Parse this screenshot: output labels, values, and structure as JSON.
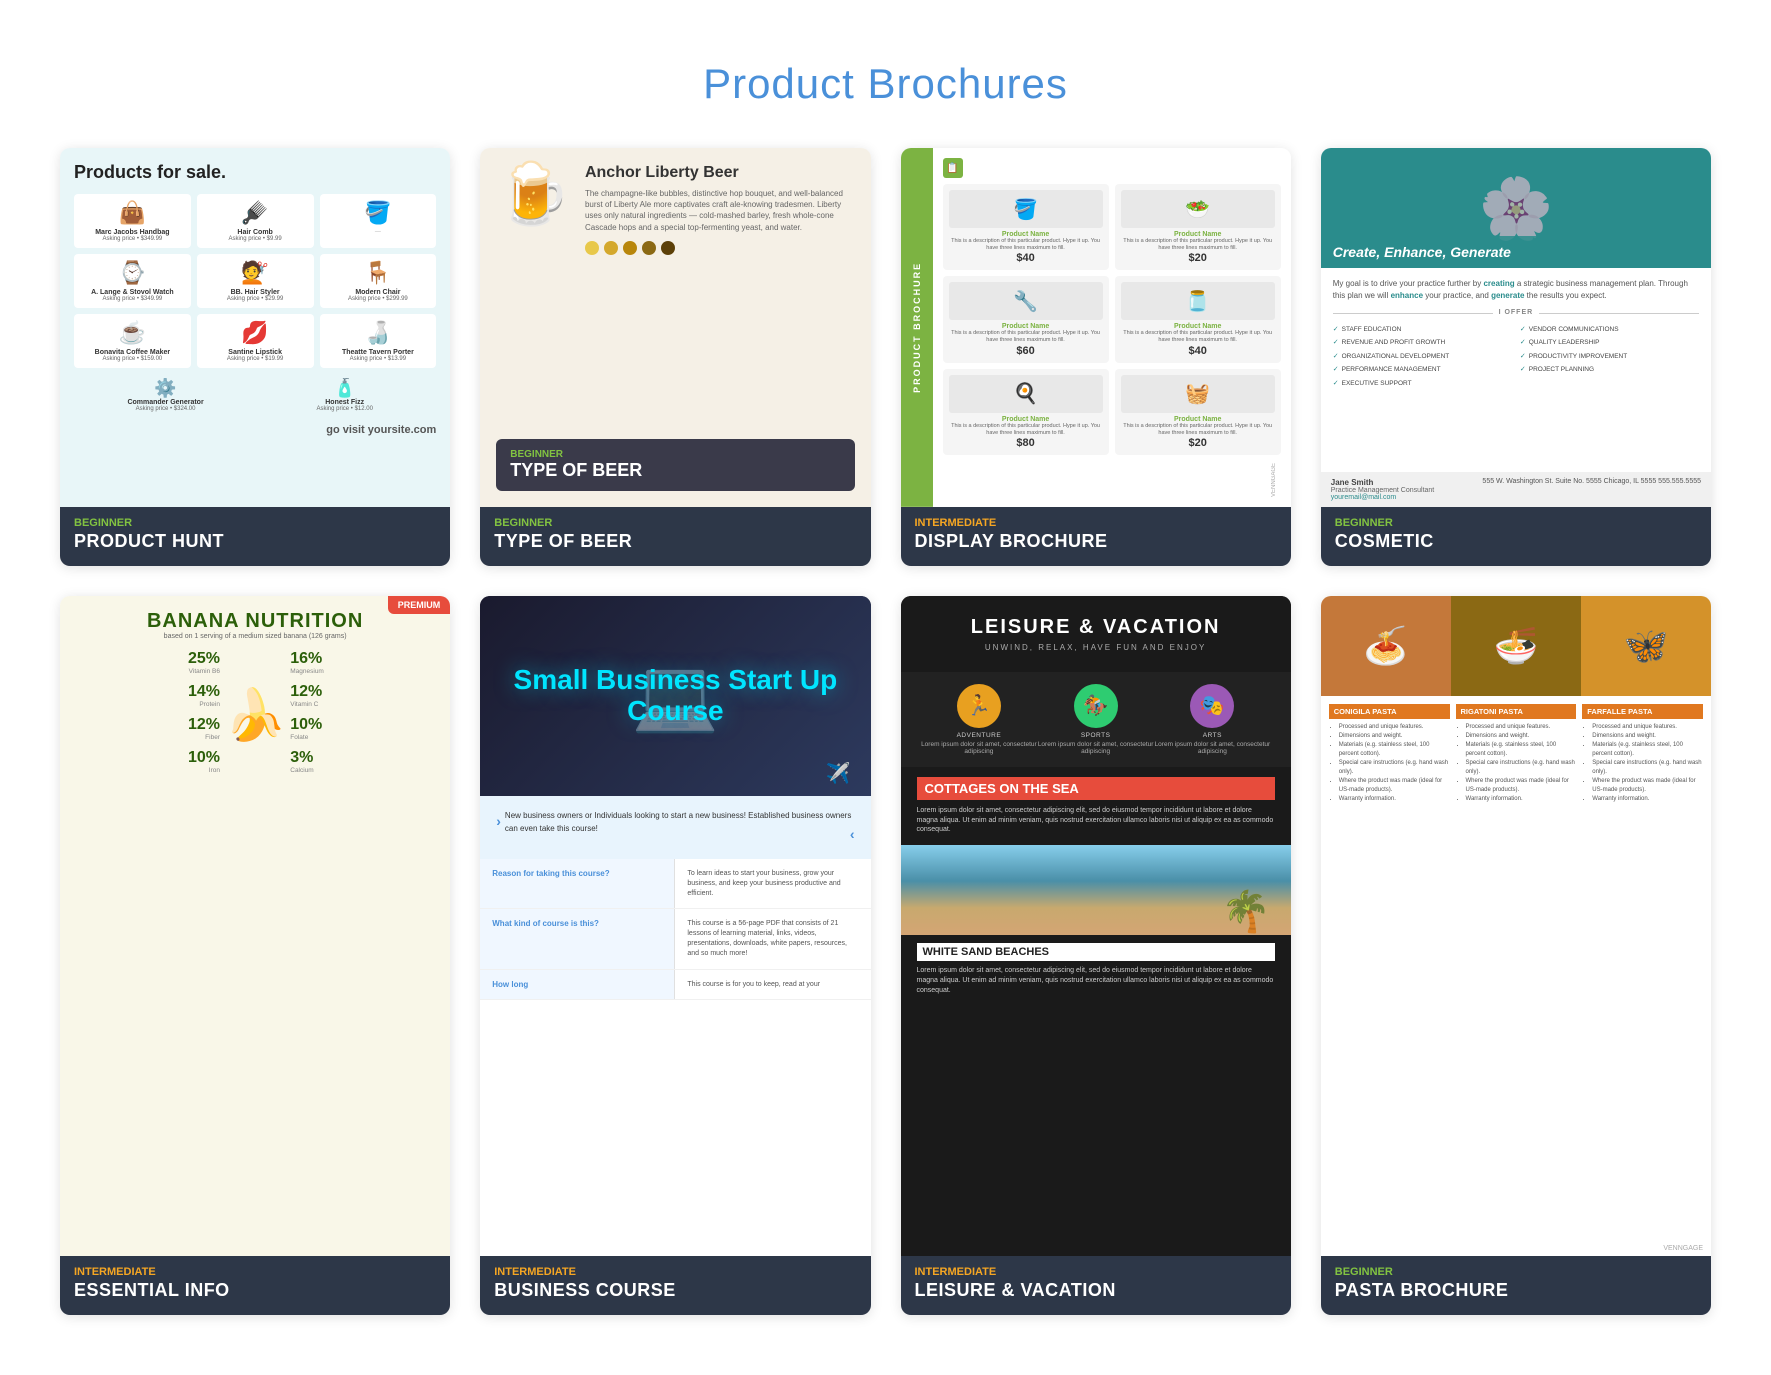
{
  "page": {
    "title": "Product Brochures"
  },
  "cards": [
    {
      "id": "product-hunt",
      "level": "BEGINNER",
      "levelClass": "beginner",
      "title": "PRODUCT HUNT",
      "preview_title": "Products for sale.",
      "products": [
        {
          "icon": "👜",
          "name": "Marc Jacobs Handbag",
          "price": "Asking price • $349.99"
        },
        {
          "icon": "🪮",
          "name": "Hair Comb",
          "price": "Asking price • $9.99"
        },
        {
          "icon": "⌚",
          "name": "A. Lange & Stovol Watch",
          "price": "Asking price • $349.99"
        },
        {
          "icon": "💅",
          "name": "BB. Hair Styler",
          "price": "Asking price • $29.99"
        },
        {
          "icon": "🪑",
          "name": "Modern Chair",
          "price": "Asking price • $299.99"
        },
        {
          "icon": "☕",
          "name": "Bonavita Coffee Maker",
          "price": "Asking price • $159.00"
        },
        {
          "icon": "💋",
          "name": "Santine Lipstick",
          "price": "Asking price • $19.99"
        },
        {
          "icon": "🍺",
          "name": "Theatte Tavern Porter",
          "price": "Asking price • $13.99"
        },
        {
          "icon": "⚙️",
          "name": "Commander Generator",
          "price": "Asking price • $324.00"
        },
        {
          "icon": "🧴",
          "name": "Honest Fizz",
          "price": "Asking price • $12.00"
        }
      ],
      "footer_text": "go visit yoursite.com"
    },
    {
      "id": "anchor-beer",
      "level": "BEGINNER",
      "levelClass": "beginner",
      "title": "TYPE OF BEER",
      "beer_name": "Anchor Liberty Beer",
      "beer_desc": "The champagne-like bubbles, distinctive hop bouquet, and well-balanced burst of Liberty Ale more captivates craft ale-knowing tradesmen. Liberty uses only natural ingredients — cold-mashed barley, fresh whole-cone Cascade hops and a special top-fermenting yeast, and water.",
      "colors": [
        "#e8c84a",
        "#d4a82c",
        "#b8860b",
        "#8B6914",
        "#5c4008"
      ]
    },
    {
      "id": "display-brochure",
      "level": "INTERMEDIATE",
      "levelClass": "intermediate",
      "title": "DISPLAY BROCHURE",
      "sidebar_text": "Product Brochure",
      "products": [
        {
          "name": "Product Name",
          "desc": "This is a description of this particular product. Hype it up. You have three lines maximum to fill.",
          "price": "$40",
          "icon": "🪣"
        },
        {
          "name": "Product Name",
          "desc": "This is a description of this particular product. Hype it up. You have three lines maximum to fill.",
          "price": "$20",
          "icon": "🥗"
        },
        {
          "name": "Product Name",
          "desc": "This is a description of this particular product. Hype it up. You have three lines maximum to fill.",
          "price": "$60",
          "icon": "🔧"
        },
        {
          "name": "Product Name",
          "desc": "This is a description of this particular product. Hype it up. You have three lines maximum to fill.",
          "price": "$40",
          "icon": "🫙"
        },
        {
          "name": "Product Name",
          "desc": "This is a description of this particular product. Hype it up. You have three lines maximum to fill.",
          "price": "$80",
          "icon": "🍳"
        },
        {
          "name": "Product Name",
          "desc": "This is a description of this particular product. Hype it up. You have three lines maximum to fill.",
          "price": "$20",
          "icon": "🧺"
        }
      ]
    },
    {
      "id": "cosmetic",
      "level": "BEGINNER",
      "levelClass": "beginner",
      "title": "COSMETIC",
      "header_text": "Create, Enhance, Generate",
      "body_intro": "My goal is to drive your practice further by creating a strategic business management plan. Through this plan we will enhance your practice, and generate the results you expect.",
      "divider": "I OFFER",
      "services": [
        "STAFF EDUCATION",
        "VENDOR COMMUNICATIONS",
        "REVENUE AND PROFIT GROWTH",
        "QUALITY LEADERSHIP",
        "ORGANIZATIONAL DEVELOPMENT",
        "PRODUCTIVITY IMPROVEMENT",
        "PERFORMANCE MANAGEMENT",
        "PROJECT PLANNING",
        "EXECUTIVE SUPPORT"
      ],
      "contact": {
        "name": "Jane Smith",
        "title": "Practice Management Consultant",
        "email": "youremail@mail.com",
        "address": "555 W. Washington St. Suite No. 5555 Chicago, IL 5555 555.555.5555"
      }
    },
    {
      "id": "banana-nutrition",
      "level": "INTERMEDIATE",
      "levelClass": "intermediate",
      "premium": true,
      "title": "ESSENTIAL INFO",
      "banana_title": "BANANA NUTRITION",
      "banana_sub": "based on 1 serving of a medium sized banana (126 grams)",
      "stats_left": [
        {
          "pct": "25%",
          "label": "Vitamin B6"
        },
        {
          "pct": "14%",
          "label": "Protein"
        },
        {
          "pct": "12%",
          "label": "Fiber"
        },
        {
          "pct": "10%",
          "label": "Iron"
        }
      ],
      "stats_right": [
        {
          "pct": "16%",
          "label": "Magnesium"
        },
        {
          "pct": "12%",
          "label": "Vitamin C"
        },
        {
          "pct": "10%",
          "label": "Folate"
        },
        {
          "pct": "3%",
          "label": "Calcium"
        }
      ],
      "emoji": "🍌"
    },
    {
      "id": "business-course",
      "level": "INTERMEDIATE",
      "levelClass": "intermediate",
      "title": "BUSINESS COURSE",
      "hero_text": "Small Business Start Up Course",
      "intro": "New business owners or Individuals looking to start a new business! Established business owners can even take this course!",
      "faq": [
        {
          "q": "Reason for taking this course?",
          "a": "To learn ideas to start your business, grow your business, and keep your business productive and efficient."
        },
        {
          "q": "What kind of course is this?",
          "a": "This course is a 56-page PDF that consists of 21 lessons of learning material, links, videos, presentations, downloads, white papers, resources, and so much more!"
        },
        {
          "q": "How long",
          "a": "This course is for you to keep, read at your"
        }
      ]
    },
    {
      "id": "leisure-vacation",
      "level": "INTERMEDIATE",
      "levelClass": "intermediate",
      "title": "LEISURE & VACATION",
      "header_subtitle": "UNWIND, RELAX, HAVE FUN AND ENJOY",
      "icons": [
        {
          "icon": "🏃",
          "color": "#e8a020",
          "label": "ADVENTURE",
          "desc": "Lorem ipsum dolor sit amet, consectetur adipiscing"
        },
        {
          "icon": "🏇",
          "color": "#2ecc71",
          "label": "SPORTS",
          "desc": "Lorem ipsum dolor sit amet, consectetur adipiscing"
        },
        {
          "icon": "🎭",
          "color": "#9b59b6",
          "label": "ARTS",
          "desc": "Lorem ipsum dolor sit amet, consectetur adipiscing"
        }
      ],
      "section1_title": "COTTAGES ON THE SEA",
      "section1_text": "Lorem ipsum dolor sit amet, consectetur adipiscing elit, sed do eiusmod tempor incididunt ut labore et dolore magna aliqua. Ut enim ad minim veniam, quis nostrud exercitation ullamco laboris nisi ut aliquip ex ea as commodo consequat.",
      "section2_title": "WHITE SAND BEACHES",
      "section2_text": "Lorem ipsum dolor sit amet, consectetur adipiscing elit, sed do eiusmod tempor incididunt ut labore et dolore magna aliqua. Ut enim ad minim veniam, quis nostrud exercitation ullamco laboris nisi ut aliquip ex ea as commodo consequat."
    },
    {
      "id": "pasta-brochure",
      "level": "BEGINNER",
      "levelClass": "beginner",
      "title": "PASTA BROCHURE",
      "pastas": [
        {
          "name": "CONIGILA PASTA",
          "color": "#e07820",
          "icon": "🍝",
          "features": [
            "Processed and unique features.",
            "Dimensions and weight.",
            "Materials (e.g. stainless steel, 100 percent cotton).",
            "Special care instructions (e.g. hand wash only).",
            "Where the product was made (ideal for US-made products).",
            "Warranty information."
          ]
        },
        {
          "name": "RIGATONI PASTA",
          "color": "#e07820",
          "icon": "🍜",
          "features": [
            "Processed and unique features.",
            "Dimensions and weight.",
            "Materials (e.g. stainless steel, 100 percent cotton).",
            "Special care instructions (e.g. hand wash only).",
            "Where the product was made (ideal for US-made products).",
            "Warranty information."
          ]
        },
        {
          "name": "FARFALLE PASTA",
          "color": "#e07820",
          "icon": "🦋",
          "features": [
            "Processed and unique features.",
            "Dimensions and weight.",
            "Materials (e.g. stainless steel, 100 percent cotton).",
            "Special care instructions (e.g. hand wash only).",
            "Where the product was made (ideal for US-made products).",
            "Warranty information."
          ]
        }
      ],
      "branding": "VENNGAGE"
    }
  ]
}
